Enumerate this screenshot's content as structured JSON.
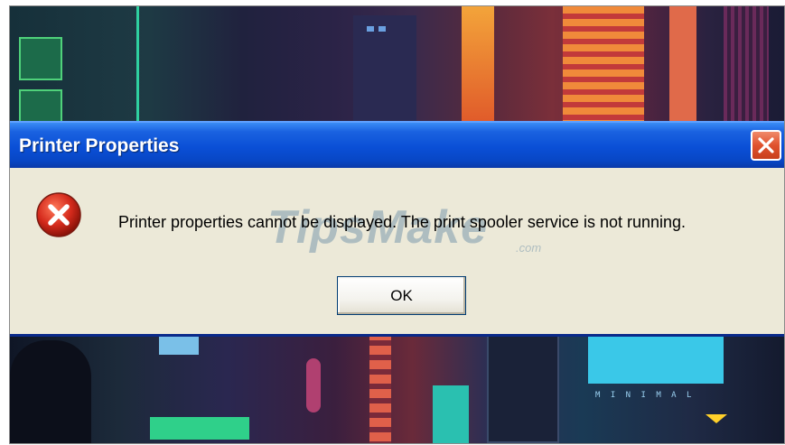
{
  "dialog": {
    "title": "Printer Properties",
    "message": "Printer properties cannot be displayed. The print spooler service is not running.",
    "ok_label": "OK",
    "icon": "error-icon",
    "close_icon": "close-icon"
  },
  "watermark": {
    "text": "TipsMake",
    "suffix": ".com"
  },
  "wallpaper": {
    "text": "M I N I M A L"
  },
  "colors": {
    "titlebar": "#0a4fd6",
    "dialog_bg": "#ece9d8",
    "close_button": "#e0522e",
    "error_red": "#d42a1c"
  }
}
